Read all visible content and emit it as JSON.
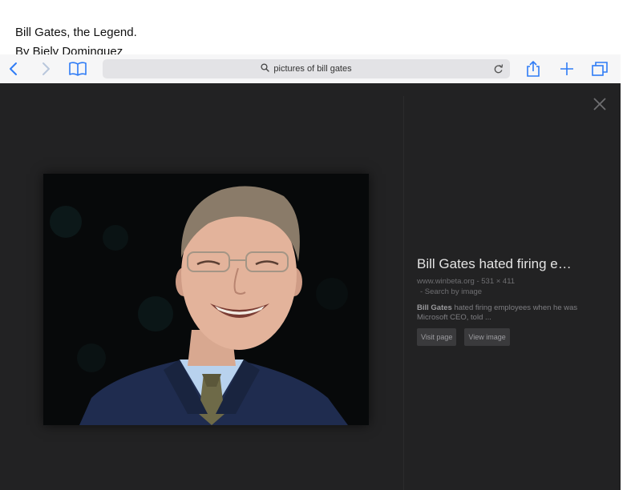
{
  "document": {
    "title": "Bill Gates, the Legend.",
    "author": "By Biely Dominguez"
  },
  "browser": {
    "url_text": "pictures of bill gates",
    "accent_color": "#2f7cf6",
    "icons": [
      "back-icon",
      "forward-icon",
      "bookmarks-icon",
      "search-icon",
      "reload-icon",
      "share-icon",
      "new-tab-icon",
      "tabs-icon"
    ]
  },
  "viewer": {
    "close_icon": "close-icon",
    "info": {
      "title": "Bill Gates hated firing e…",
      "source": "www.winbeta.org - 531 × 411",
      "search_by_image": "- Search by image",
      "desc_bold": "Bill Gates",
      "desc_rest": " hated firing employees when he was Microsoft CEO, told ...",
      "visit_page": "Visit page",
      "view_image": "View image"
    }
  }
}
